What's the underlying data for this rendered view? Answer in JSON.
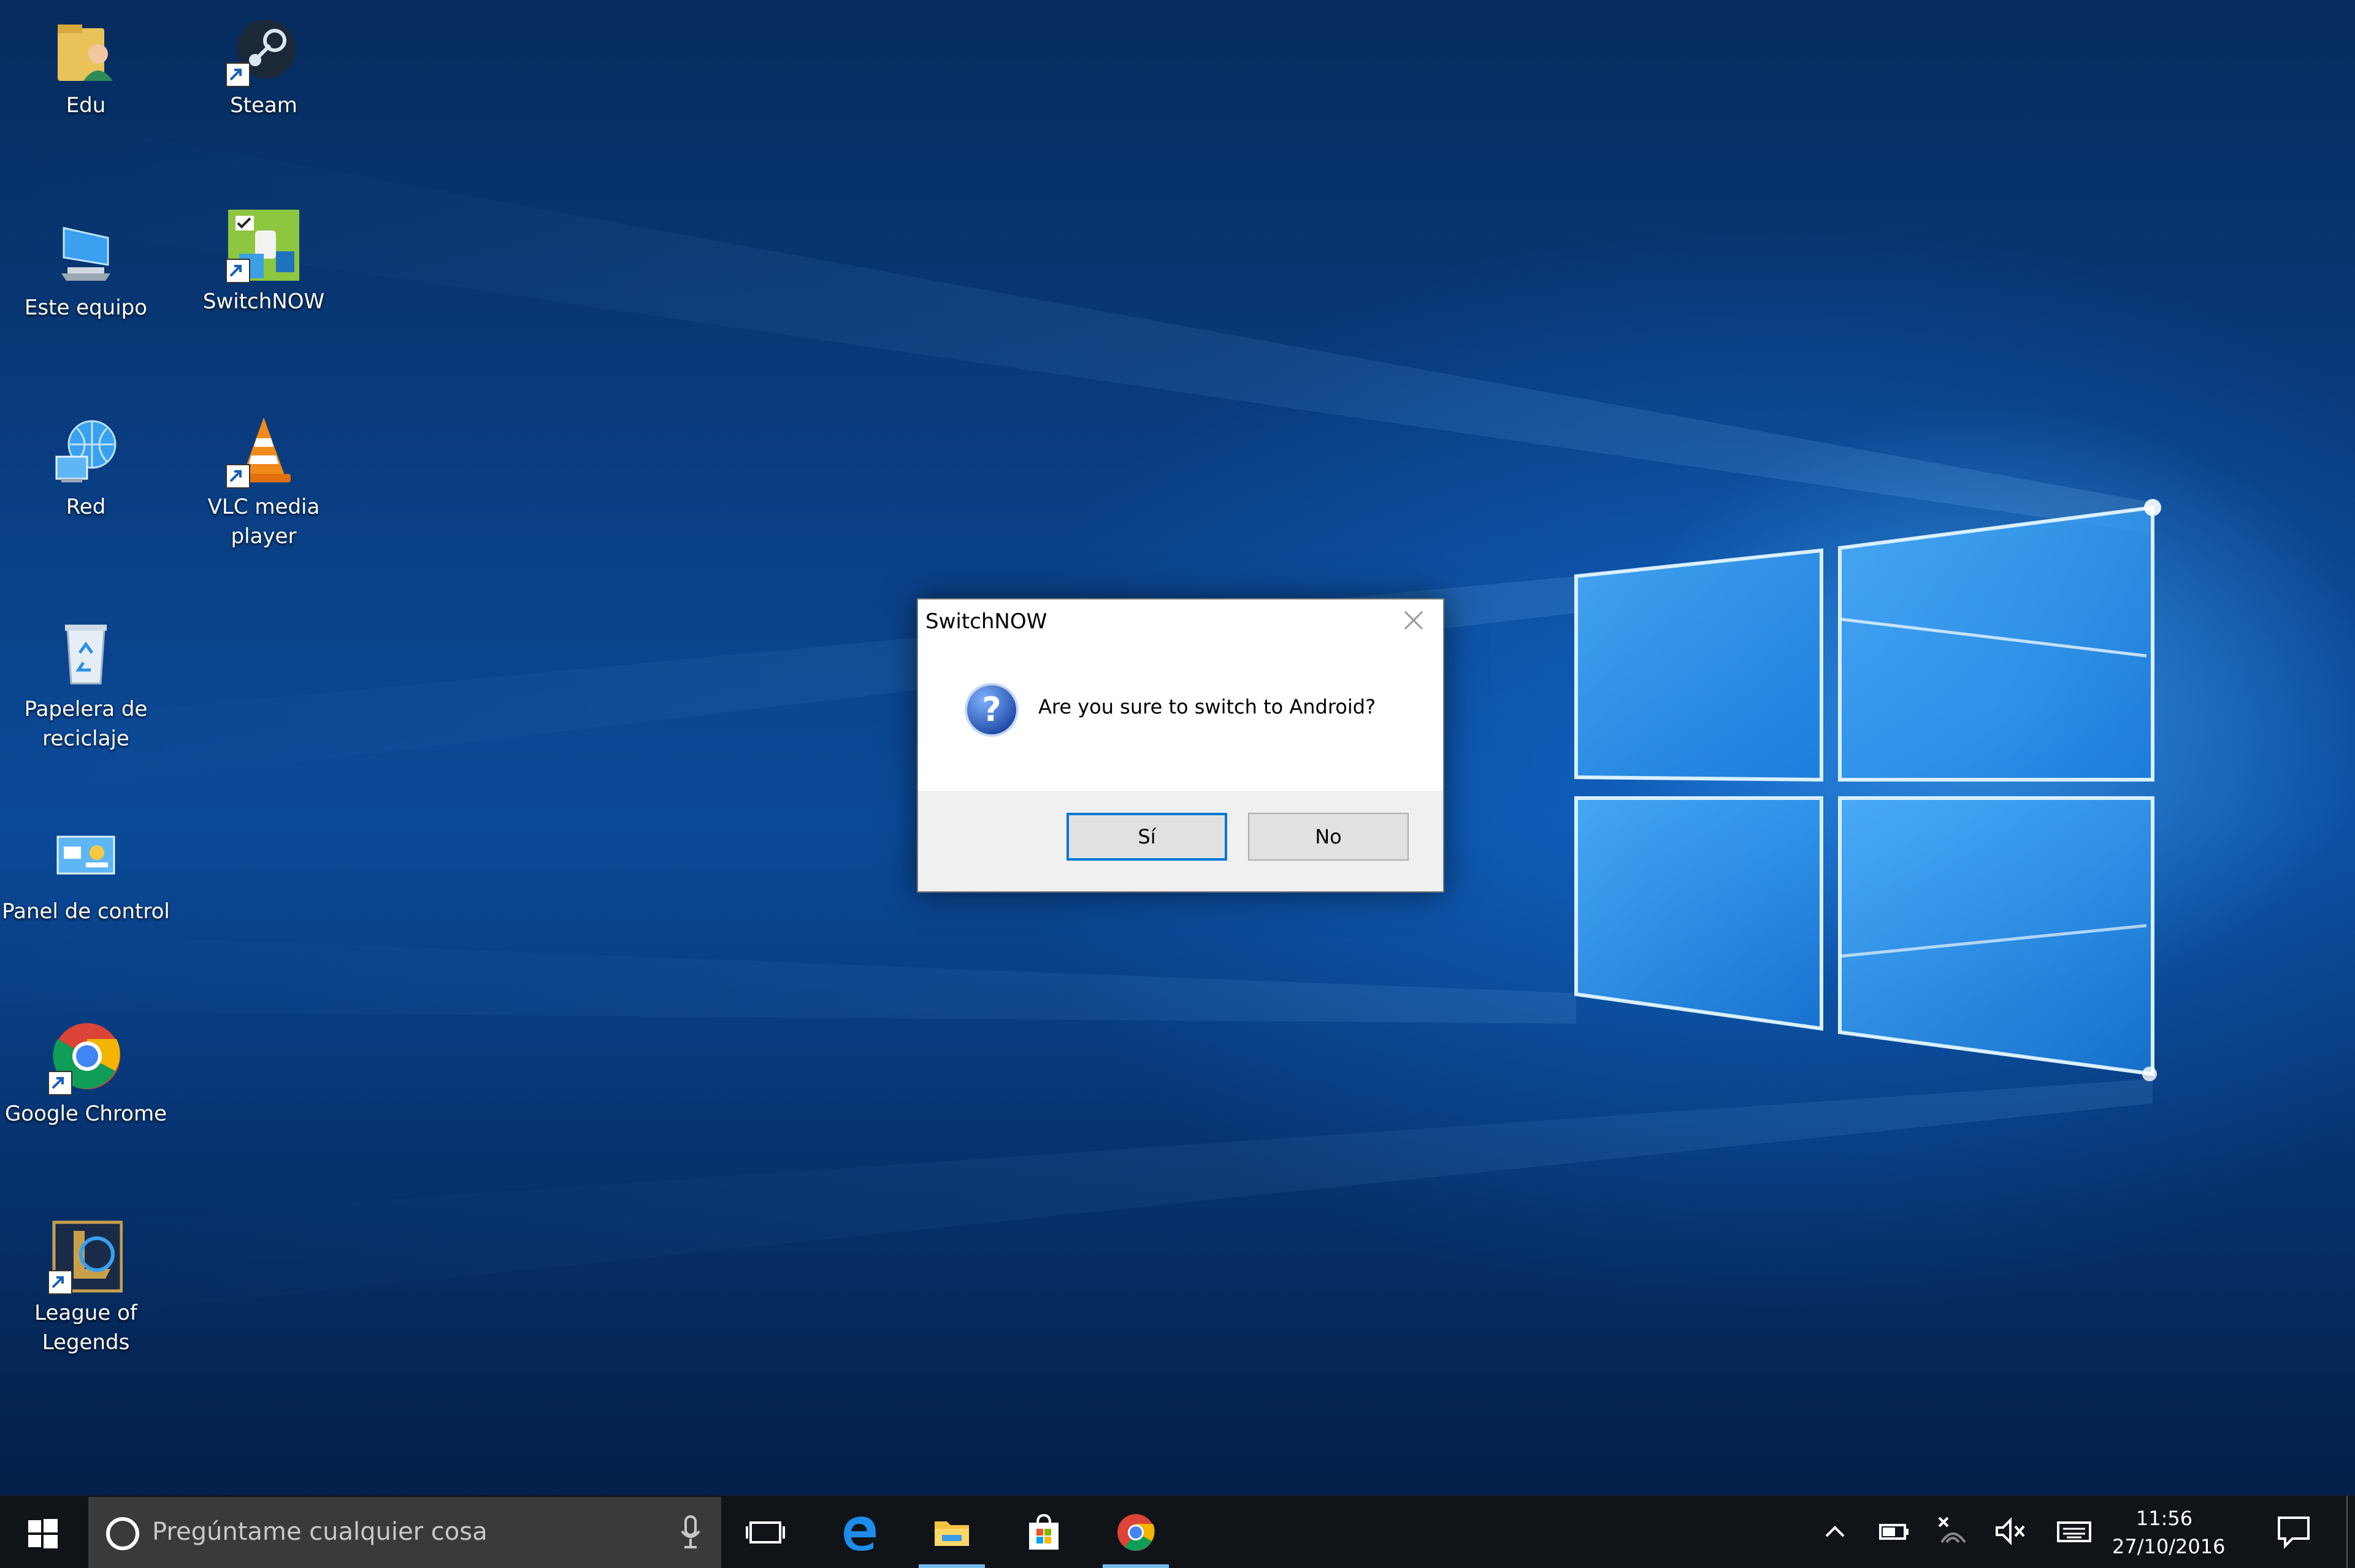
{
  "desktop": {
    "icons": [
      {
        "label": "Edu",
        "icon": "user-folder-icon"
      },
      {
        "label": "Steam",
        "icon": "steam-icon"
      },
      {
        "label": "Este equipo",
        "icon": "computer-icon"
      },
      {
        "label": "SwitchNOW",
        "icon": "switchnow-icon"
      },
      {
        "label": "Red",
        "icon": "network-icon"
      },
      {
        "label": "VLC media player",
        "icon": "vlc-icon"
      },
      {
        "label": "Papelera de reciclaje",
        "icon": "recycle-bin-icon"
      },
      {
        "label": "Panel de control",
        "icon": "control-panel-icon"
      },
      {
        "label": "Google Chrome",
        "icon": "chrome-icon"
      },
      {
        "label": "League of Legends",
        "icon": "league-of-legends-icon"
      }
    ]
  },
  "dialog": {
    "title": "SwitchNOW",
    "message": "Are you sure to switch to Android?",
    "buttons": {
      "yes": "Sí",
      "no": "No"
    },
    "icon": "question-icon"
  },
  "taskbar": {
    "search_placeholder": "Pregúntame cualquier cosa",
    "apps": [
      "task-view-icon",
      "edge-icon",
      "file-explorer-icon",
      "store-icon",
      "chrome-icon"
    ],
    "clock": {
      "time": "11:56",
      "date": "27/10/2016"
    },
    "colors": {
      "taskbar": "#101318",
      "search": "#3a3a3a",
      "accent": "#0078d7"
    }
  }
}
